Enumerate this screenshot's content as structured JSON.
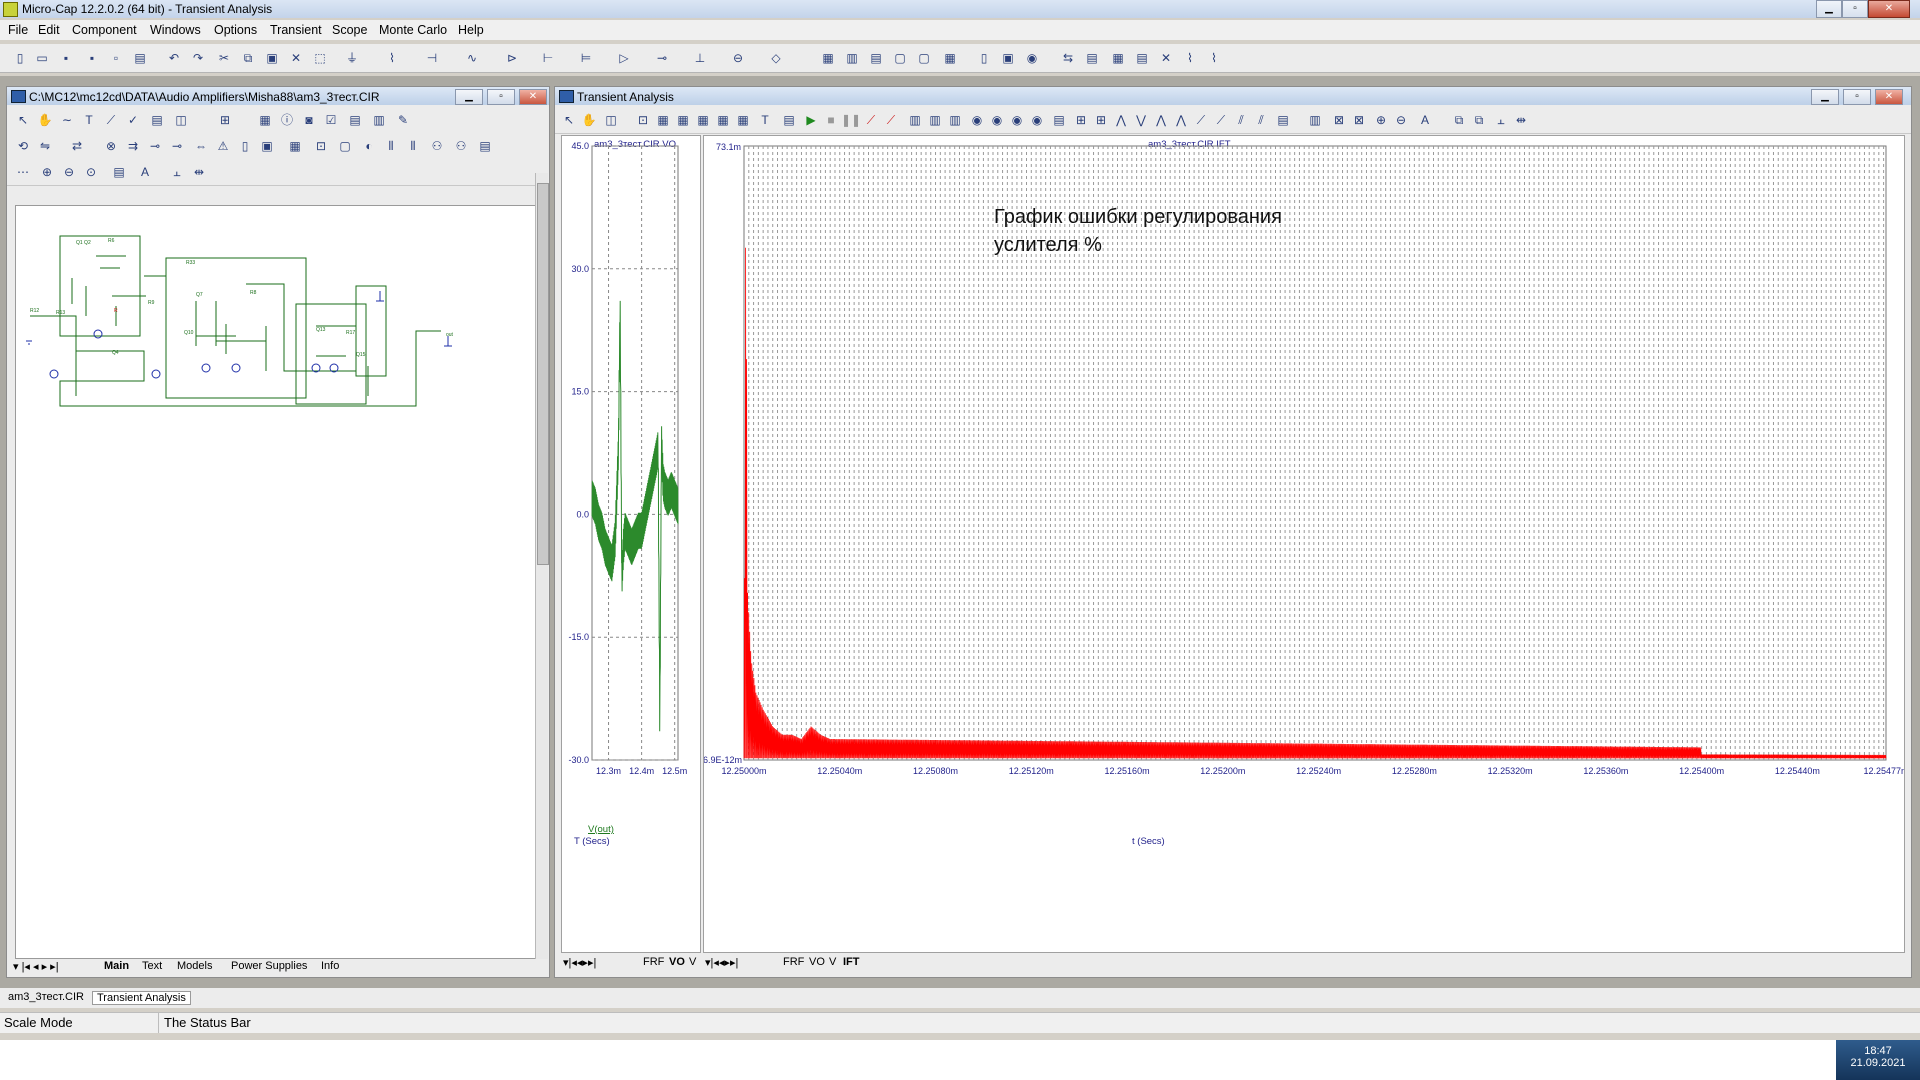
{
  "window": {
    "title": "Micro-Cap 12.2.0.2 (64 bit) - Transient Analysis"
  },
  "menu": [
    "File",
    "Edit",
    "Component",
    "Windows",
    "Options",
    "Transient",
    "Scope",
    "Monte Carlo",
    "Help"
  ],
  "schematic_window": {
    "title": "C:\\MC12\\mc12cd\\DATA\\Audio Amplifiers\\Misha88\\am3_3тест.CIR",
    "tabs": [
      "Main",
      "Text",
      "Models",
      "Power Supplies",
      "Info"
    ]
  },
  "analysis_window": {
    "title": "Transient Analysis"
  },
  "left_plot": {
    "title": "am3_3тест.CIR VO",
    "y_ticks": [
      "45.0",
      "30.0",
      "15.0",
      "0.0",
      "-15.0",
      "-30.0"
    ],
    "x_ticks": [
      "12.3m",
      "12.4m",
      "12.5m"
    ],
    "xlabel": "T (Secs)",
    "trace_label": "V(out)",
    "tabs": [
      "FRF",
      "VO",
      "V"
    ]
  },
  "right_plot": {
    "title": "am3_3тест.CIR IFT",
    "y_top": "73.1m",
    "y_bottom": "6.9E-12m",
    "x_ticks": [
      "12.25000m",
      "12.25040m",
      "12.25080m",
      "12.25120m",
      "12.25160m",
      "12.25200m",
      "12.25240m",
      "12.25280m",
      "12.25320m",
      "12.25360m",
      "12.25400m",
      "12.25440m",
      "12.25477m"
    ],
    "xlabel": "t (Secs)",
    "annotation_line1": "График ошибки регулирования",
    "annotation_line2": "услителя %",
    "tabs": [
      "FRF",
      "VO",
      "V",
      "IFT"
    ]
  },
  "doc_tabs": [
    "am3_3тест.CIR",
    "Transient Analysis"
  ],
  "status": {
    "mode": "Scale Mode",
    "text": "The Status Bar"
  },
  "clock": {
    "time": "18:47",
    "date": "21.09.2021"
  },
  "chart_data": [
    {
      "type": "line",
      "title": "am3_3тест.CIR VO",
      "xlabel": "T (Secs)",
      "ylabel": "",
      "ylim": [
        -30,
        45
      ],
      "x_ticks": [
        "12.3m",
        "12.4m",
        "12.5m"
      ],
      "series": [
        {
          "name": "V(out)",
          "color": "#2c8a2c",
          "x": [
            12.25,
            12.26,
            12.27,
            12.28,
            12.29,
            12.3,
            12.31,
            12.32,
            12.33,
            12.335,
            12.34,
            12.345,
            12.35,
            12.36,
            12.37,
            12.38,
            12.39,
            12.4,
            12.41,
            12.42,
            12.43,
            12.44,
            12.45,
            12.455,
            12.46,
            12.465,
            12.47,
            12.48,
            12.49,
            12.5,
            12.51
          ],
          "values": [
            2,
            1,
            -1,
            -2,
            -4,
            -5,
            -6,
            -3,
            8,
            26,
            -8,
            -4,
            -2,
            -3,
            -4,
            -3,
            -2,
            -2,
            0,
            2,
            4,
            6,
            8,
            -26,
            9,
            4,
            3,
            2,
            3,
            2,
            1
          ]
        }
      ]
    },
    {
      "type": "line",
      "title": "am3_3тест.CIR IFT",
      "xlabel": "t (Secs)",
      "ylabel": "",
      "ylim": [
        0,
        73.1
      ],
      "y_unit": "m",
      "series": [
        {
          "name": "IFT",
          "color": "#ff0000",
          "x": [
            12.25,
            12.2500075,
            12.250015,
            12.25003,
            12.25005,
            12.25008,
            12.25012,
            12.25016,
            12.2502,
            12.25024,
            12.25028,
            12.25032,
            12.25036,
            12.254,
            12.25044,
            12.25477
          ],
          "values": [
            2,
            70,
            20,
            12,
            8,
            6,
            4,
            3,
            3,
            2.5,
            4,
            3,
            2.5,
            1.5,
            1,
            0.6
          ]
        }
      ]
    }
  ]
}
